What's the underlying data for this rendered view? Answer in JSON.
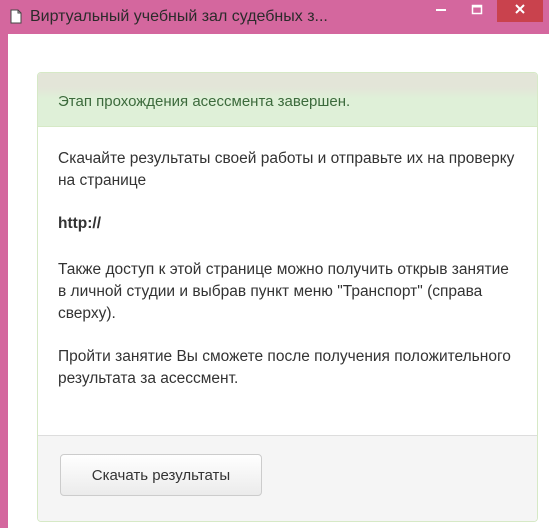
{
  "window": {
    "title": "Виртуальный учебный зал судебных з...",
    "icons": {
      "app": "document-icon",
      "minimize": "minimize-icon",
      "maximize": "maximize-icon",
      "close": "close-icon"
    },
    "colors": {
      "frame": "#d4679e",
      "close": "#c9424d"
    }
  },
  "alert": {
    "text": "Этап прохождения асессмента завершен."
  },
  "content": {
    "instruction": "Скачайте результаты своей работы и отправьте их на проверку на странице",
    "link": "http://",
    "access_note": "Также доступ к этой странице можно получить открыв занятие в личной студии и выбрав пункт меню \"Транспорт\" (справа сверху).",
    "continue_note": "Пройти занятие Вы сможете после получения положительного результата за асессмент."
  },
  "footer": {
    "download_button": "Скачать результаты"
  }
}
